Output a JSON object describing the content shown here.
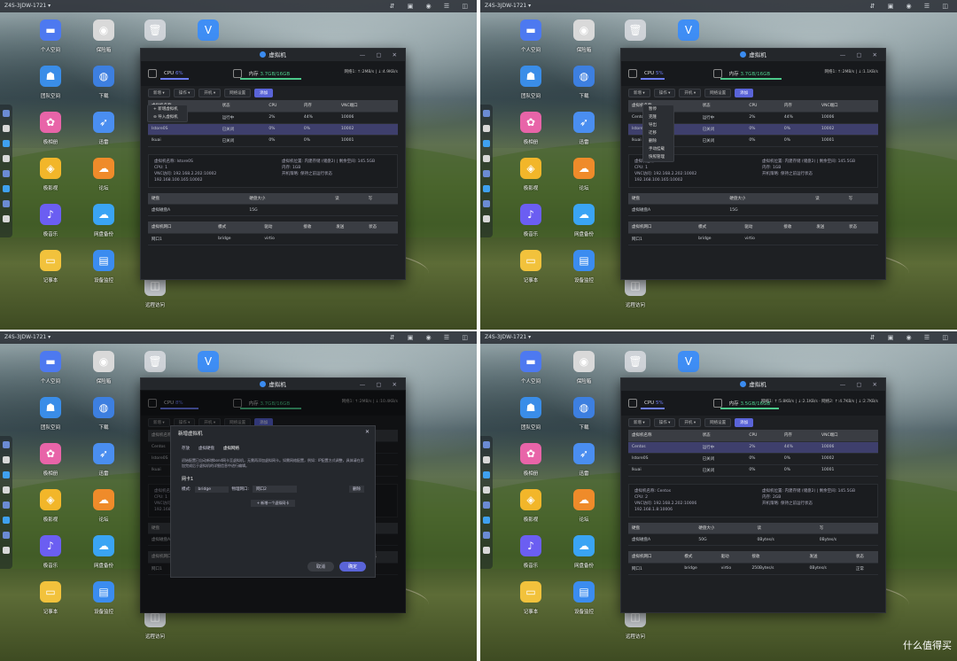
{
  "titlebar": {
    "device": "Z4S-3JDW-1721 ▾"
  },
  "window": {
    "title": "虚拟机"
  },
  "apps": [
    {
      "label": "个人空间",
      "icon": "folder-icon",
      "color": "#4d79f0"
    },
    {
      "label": "保险箱",
      "icon": "safe-icon",
      "color": "#d9d9d9"
    },
    {
      "label": "",
      "icon": "trash-icon",
      "color": "#cfd3d8"
    },
    {
      "label": "",
      "icon": "v-shield-icon",
      "color": "#3f8ef5"
    },
    {
      "label": "团队空间",
      "icon": "team-icon",
      "color": "#3a8de8"
    },
    {
      "label": "下载",
      "icon": "globe-download-icon",
      "color": "#3d7fe0"
    },
    {
      "label": "极相册",
      "icon": "photos-icon",
      "color": "#e864a8"
    },
    {
      "label": "迅雷",
      "icon": "xunlei-bird-icon",
      "color": "#4a8ef0"
    },
    {
      "label": "极影视",
      "icon": "video-icon",
      "color": "#f2b62a"
    },
    {
      "label": "论坛",
      "icon": "forum-icon",
      "color": "#ef8b2a"
    },
    {
      "label": "极音乐",
      "icon": "music-icon",
      "color": "#6b5ef2"
    },
    {
      "label": "网盘备份",
      "icon": "cloud-backup-icon",
      "color": "#3aa4f4"
    },
    {
      "label": "记事本",
      "icon": "notepad-icon",
      "color": "#f2c23c"
    },
    {
      "label": "设备监控",
      "icon": "monitor-chart-icon",
      "color": "#3b8cf0"
    },
    {
      "label": "远程访问",
      "icon": "remote-icon",
      "color": "#c0c4c8"
    }
  ],
  "stats": [
    {
      "cpu_label": "CPU",
      "cpu": "6%",
      "mem_label": "内存",
      "mem": "3.7GB/16GB",
      "net": "网络1: ↑:2MB/s | ↓:4.9KB/s",
      "cpu_frac": 0.06,
      "mem_frac": 0.23
    },
    {
      "cpu_label": "CPU",
      "cpu": "5%",
      "mem_label": "内存",
      "mem": "3.7GB/16GB",
      "net": "网络1: ↑:2MB/s | ↓:1.1KB/s",
      "cpu_frac": 0.05,
      "mem_frac": 0.23
    },
    {
      "cpu_label": "CPU",
      "cpu": "8%",
      "mem_label": "内存",
      "mem": "3.7GB/16GB",
      "net": "网络1: ↑:2MB/s | ↓:10.4KB/s",
      "cpu_frac": 0.08,
      "mem_frac": 0.23
    },
    {
      "cpu_label": "CPU",
      "cpu": "5%",
      "mem_label": "内存",
      "mem": "3.5GB/16GB",
      "net": "网络1: ↑:5.8KB/s | ↓:2.1KB/s · 网络2: ↑:4.7KB/s | ↓:2.7KB/s",
      "cpu_frac": 0.05,
      "mem_frac": 0.22
    }
  ],
  "toolbar": [
    "新增 ▾",
    "操作 ▾",
    "开机 ▾",
    "网络设置",
    "添加"
  ],
  "table": {
    "headers": [
      "虚拟机名称",
      "状态",
      "CPU",
      "内存",
      "VNC端口"
    ],
    "rows": [
      [
        "Centos",
        "运行中",
        "2%",
        "44%",
        "10006"
      ],
      [
        "Istore0S",
        "已关闭",
        "0%",
        "0%",
        "10002"
      ],
      [
        "lkuai",
        "已关闭",
        "0%",
        "0%",
        "10001"
      ]
    ]
  },
  "new_menu": [
    "+ 新增虚拟机",
    "⊖ 导入虚拟机"
  ],
  "op_menu": [
    "暂停",
    "克隆",
    "导出",
    "迁移",
    "删除",
    "手动挂载",
    "快照管理"
  ],
  "detail": {
    "name": "虚拟机名称: Istore0S",
    "cpu": "CPU: 1",
    "vnc": "VNC访问: 192.168.2.202:10002",
    "vnc2": "192.168.100.165:10002",
    "disk_loc": "虚拟机位置: 内建存储 (储盘2) | 剩余空间: 145.5GB",
    "mem": "内存: 1GB",
    "autostart": "开机策略: 保持之前运行状态",
    "disk_headers": [
      "硬盘",
      "硬盘大小",
      "读",
      "写"
    ],
    "disk_row": [
      "虚拟磁盘A",
      "15G",
      "",
      ""
    ],
    "net_headers": [
      "虚拟机网口",
      "模式",
      "驱动",
      "接收",
      "发送",
      "状态"
    ],
    "net_row": [
      "网口1",
      "bridge",
      "virtio",
      "",
      "",
      ""
    ]
  },
  "detail4": {
    "name": "虚拟机名称: Centos",
    "cpu": "CPU: 2",
    "vnc": "VNC访问: 192.168.2.202:10006",
    "vnc2": "192.168.1.8:10006",
    "mem": "内存: 2GB",
    "disk_row": [
      "虚拟磁盘A",
      "50G",
      "0Bytes/s",
      "0Bytes/s"
    ],
    "net_row": [
      "网口1",
      "bridge",
      "virtio",
      "250Bytes/s",
      "0Bytes/s",
      "正常"
    ]
  },
  "modal": {
    "title": "新增虚拟机",
    "steps": [
      "存放",
      "虚拟硬盘",
      "虚拟网络"
    ],
    "desc": "初始配置已自动新增bond网卡至虚拟机，无需再添加虚拟网卡。如需网络配置，例如：IP配置方式调整，具体请在添加完成后于虚拟机的详细信息中进行编辑。",
    "nic": "网卡1",
    "mode_label": "模式:",
    "mode_value": "bridge",
    "host_label": "物理网口:",
    "host_value": "网口2",
    "delete": "删除",
    "add": "+ 新增一个虚拟网卡",
    "cancel": "取消",
    "ok": "确定"
  },
  "brand": "什么值得买",
  "accent": "#5a64d8"
}
